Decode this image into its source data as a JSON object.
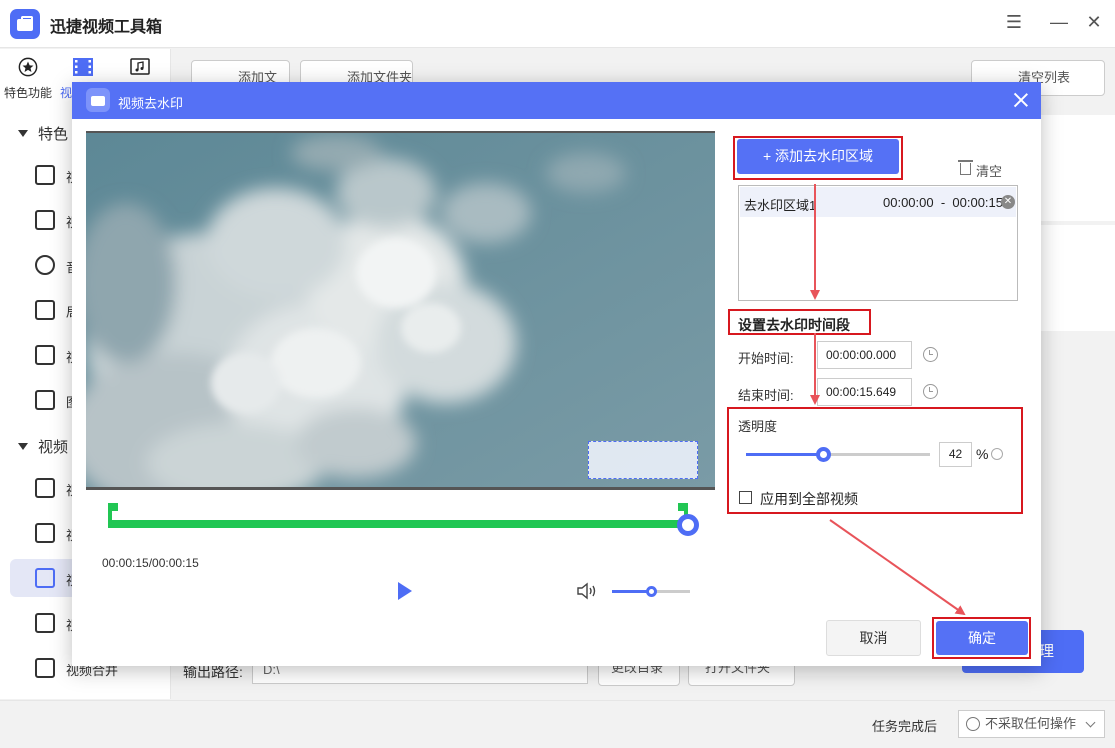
{
  "app": {
    "title": "迅捷视频工具箱",
    "window_controls": [
      "☰",
      "—",
      "✕"
    ]
  },
  "top_tabs": [
    {
      "label": "特色功能",
      "icon": "star-icon"
    },
    {
      "label": "视",
      "icon": "film-icon"
    },
    {
      "label": "",
      "icon": "music-icon"
    }
  ],
  "sidebar": {
    "sections": [
      {
        "label": "特色"
      },
      {
        "label": "视频"
      }
    ],
    "items": [
      {
        "label": "视",
        "icon": "crop-icon"
      },
      {
        "label": "视",
        "icon": "rotate-icon"
      },
      {
        "label": "音",
        "icon": "audio-icon"
      },
      {
        "label": "局",
        "icon": "screen-play-icon"
      },
      {
        "label": "视",
        "icon": "text-image-icon"
      },
      {
        "label": "图",
        "icon": "image-icon"
      },
      {
        "label": "视",
        "icon": "subtitle-icon"
      },
      {
        "label": "视",
        "icon": "add-clip-icon"
      },
      {
        "label": "视",
        "icon": "watermark-remove-icon"
      },
      {
        "label": "视",
        "icon": "split-icon"
      },
      {
        "label": "视频合并",
        "icon": "merge-icon"
      }
    ]
  },
  "toolbar": {
    "add_file": "添加文件",
    "add_folder": "添加文件夹",
    "clear_list": "清空列表"
  },
  "output": {
    "label": "输出路径:",
    "path": "D:\\",
    "change_dir": "更改目录",
    "open_folder": "打开文件夹",
    "process_btn": "理"
  },
  "footer": {
    "after_task_label": "任务完成后",
    "after_task_value": "不采取任何操作"
  },
  "dialog": {
    "title": "视频去水印",
    "player": {
      "timecode": "00:00:15/00:00:15",
      "volume_fraction": 0.5
    },
    "add_region_button": "+ 添加去水印区域",
    "clear_button": "清空",
    "regions": [
      {
        "name": "去水印区域1",
        "start": "00:00:00",
        "end": "00:00:15"
      }
    ],
    "time_section_title": "设置去水印时间段",
    "start_time_label": "开始时间:",
    "start_time_value": "00:00:00.000",
    "end_time_label": "结束时间:",
    "end_time_value": "00:00:15.649",
    "opacity_label": "透明度",
    "opacity_value": "42",
    "opacity_unit": "%",
    "apply_all_label": "应用到全部视频",
    "cancel_button": "取消",
    "ok_button": "确定"
  },
  "colors": {
    "accent": "#5571f5",
    "timeline": "#21c653",
    "highlight": "#d7181f",
    "arrow": "#e8545a"
  }
}
